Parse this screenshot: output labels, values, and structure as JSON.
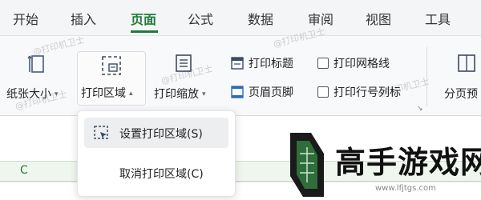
{
  "tabs": [
    {
      "label": "开始"
    },
    {
      "label": "插入"
    },
    {
      "label": "页面"
    },
    {
      "label": "公式"
    },
    {
      "label": "数据"
    },
    {
      "label": "审阅"
    },
    {
      "label": "视图"
    },
    {
      "label": "工具"
    }
  ],
  "active_tab": "页面",
  "ribbon": {
    "paper_size": "纸张大小",
    "print_area": "打印区域",
    "print_scale": "打印缩放",
    "print_title": "打印标题",
    "header_footer": "页眉页脚",
    "print_gridlines": "打印网格线",
    "print_row_col_labels": "打印行号列标",
    "page_break_preview": "分页预"
  },
  "dropdown": {
    "set_print_area": "设置打印区域(S)",
    "cancel_print_area": "取消打印区域(C)"
  },
  "sheet": {
    "column_c": "C"
  },
  "watermark": "@打印机卫士",
  "brand": {
    "name": "高手游戏网",
    "url": "www.lfjtgs.com"
  },
  "colors": {
    "accent": "#1f7a3a",
    "ribbon_bg": "#f8f9fa",
    "hover_bg": "#eceef0"
  }
}
